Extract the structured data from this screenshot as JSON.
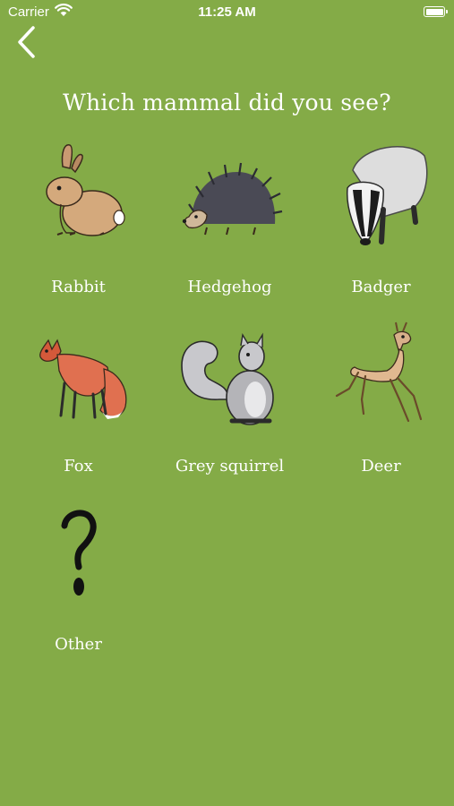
{
  "status": {
    "carrier": "Carrier",
    "time": "11:25 AM"
  },
  "header": {
    "back_icon": "chevron-left-icon",
    "title": "Which mammal did you see?"
  },
  "mammals": [
    {
      "label": "Rabbit",
      "icon": "rabbit-icon"
    },
    {
      "label": "Hedgehog",
      "icon": "hedgehog-icon"
    },
    {
      "label": "Badger",
      "icon": "badger-icon"
    },
    {
      "label": "Fox",
      "icon": "fox-icon"
    },
    {
      "label": "Grey squirrel",
      "icon": "squirrel-icon"
    },
    {
      "label": "Deer",
      "icon": "deer-icon"
    },
    {
      "label": "Other",
      "icon": "question-mark-icon"
    }
  ],
  "colors": {
    "background": "#84ab47",
    "text": "#ffffff"
  }
}
